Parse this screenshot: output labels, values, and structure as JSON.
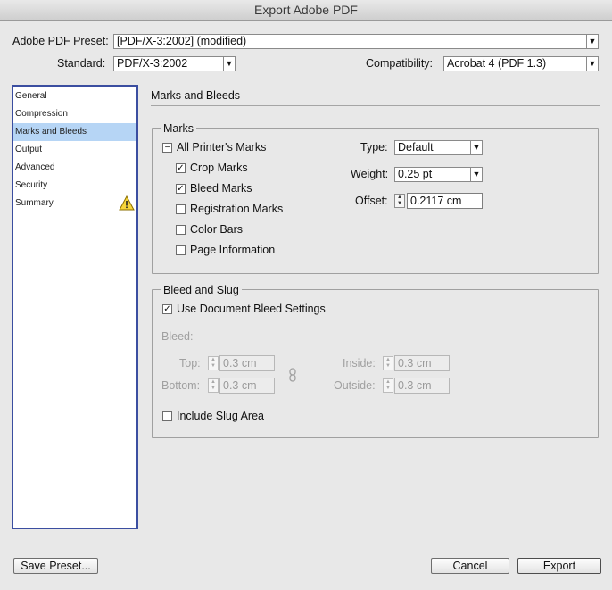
{
  "window": {
    "title": "Export Adobe PDF"
  },
  "header": {
    "preset_label": "Adobe PDF Preset:",
    "preset_value": "[PDF/X-3:2002] (modified)",
    "standard_label": "Standard:",
    "standard_value": "PDF/X-3:2002",
    "compatibility_label": "Compatibility:",
    "compatibility_value": "Acrobat 4 (PDF 1.3)"
  },
  "sidebar": {
    "items": [
      {
        "label": "General"
      },
      {
        "label": "Compression"
      },
      {
        "label": "Marks and Bleeds",
        "selected": true
      },
      {
        "label": "Output"
      },
      {
        "label": "Advanced"
      },
      {
        "label": "Security"
      },
      {
        "label": "Summary",
        "icon": "warning-icon"
      }
    ]
  },
  "panel": {
    "title": "Marks and Bleeds",
    "marks": {
      "group_label": "Marks",
      "all_printers_marks": {
        "label": "All Printer's Marks",
        "state": "mixed"
      },
      "crop_marks": {
        "label": "Crop Marks",
        "checked": true
      },
      "bleed_marks": {
        "label": "Bleed Marks",
        "checked": true
      },
      "registration_marks": {
        "label": "Registration Marks",
        "checked": false
      },
      "color_bars": {
        "label": "Color Bars",
        "checked": false
      },
      "page_information": {
        "label": "Page Information",
        "checked": false
      },
      "type_label": "Type:",
      "type_value": "Default",
      "weight_label": "Weight:",
      "weight_value": "0.25 pt",
      "offset_label": "Offset:",
      "offset_value": "0.2117 cm"
    },
    "bleed": {
      "group_label": "Bleed and Slug",
      "use_doc_bleed": {
        "label": "Use Document Bleed Settings",
        "checked": true
      },
      "bleed_label": "Bleed:",
      "top_label": "Top:",
      "top_value": "0.3 cm",
      "bottom_label": "Bottom:",
      "bottom_value": "0.3 cm",
      "inside_label": "Inside:",
      "inside_value": "0.3 cm",
      "outside_label": "Outside:",
      "outside_value": "0.3 cm",
      "include_slug": {
        "label": "Include Slug Area",
        "checked": false
      }
    }
  },
  "footer": {
    "save_preset": "Save Preset...",
    "cancel": "Cancel",
    "export": "Export"
  }
}
